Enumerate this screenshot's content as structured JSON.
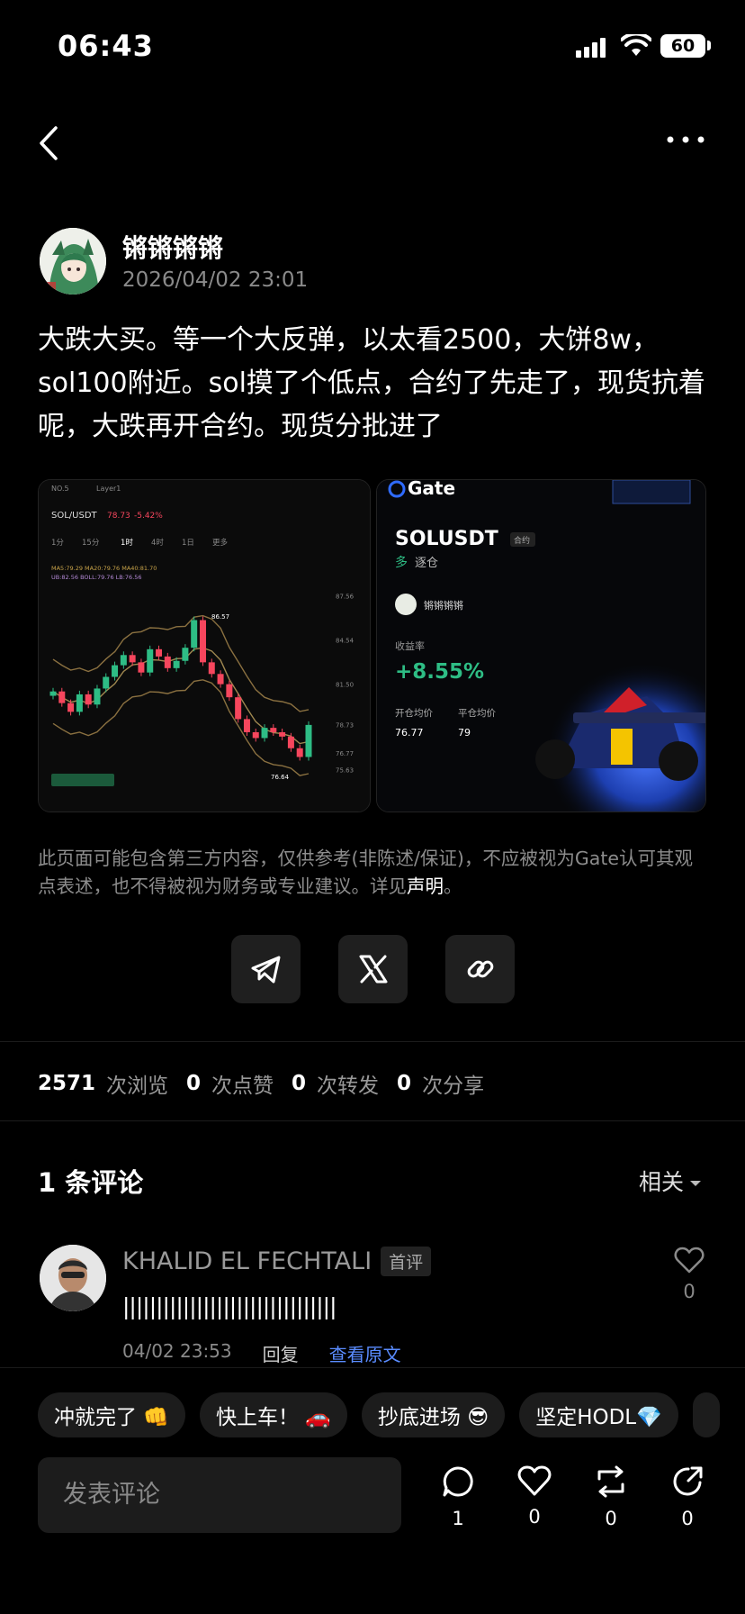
{
  "status": {
    "time": "06:43",
    "battery": "60"
  },
  "post": {
    "author": "锵锵锵锵",
    "time": "2026/04/02 23:01",
    "content": "大跌大买。等一个大反弹，以太看2500，大饼8w，sol100附近。sol摸了个低点，合约了先走了，现货抗着呢，大跌再开合约。现货分批进了",
    "chart_image": {
      "header": "NO.5",
      "layer": "Layer1",
      "pair": "SOL/USDT",
      "price": "78.73",
      "change": "-5.42%",
      "intervals": [
        "1分",
        "15分",
        "1时",
        "4时",
        "1日",
        "更多"
      ],
      "ma_line": "MA5:79.29  MA20:79.76  MA40:81.70",
      "boll_line": "UB:82.56  BOLL:79.76  LB:76.56",
      "high_marker": "86.57",
      "low_marker": "76.64",
      "y_ticks": [
        "87.56",
        "84.54",
        "81.50",
        "78.73",
        "76.77",
        "75.63"
      ],
      "chart_data": {
        "type": "line",
        "x": [
          1,
          2,
          3,
          4,
          5,
          6,
          7,
          8,
          9,
          10,
          11,
          12,
          13,
          14,
          15,
          16,
          17,
          18,
          19,
          20,
          21,
          22,
          23,
          24,
          25,
          26,
          27,
          28,
          29,
          30
        ],
        "series": [
          {
            "values": [
              81.0,
              80.2,
              79.6,
              80.8,
              80.1,
              81.2,
              82.0,
              82.8,
              83.5,
              83.0,
              82.3,
              83.9,
              83.4,
              82.6,
              83.1,
              84.0,
              85.9,
              83.0,
              82.2,
              81.5,
              80.6,
              79.1,
              78.2,
              77.8,
              78.5,
              78.2,
              77.9,
              77.1,
              76.5,
              78.7
            ]
          }
        ],
        "ylim": [
          75.6,
          87.6
        ]
      }
    },
    "pnl_card": {
      "brand": "Gate",
      "symbol": "SOLUSDT",
      "contract_tag": "合约",
      "direction": "多",
      "mode": "逐仓",
      "user": "锵锵锵锵",
      "yield_label": "收益率",
      "yield": "+8.55%",
      "open_label": "开仓均价",
      "close_label": "平仓均价",
      "open_price": "76.77",
      "close_price": "79"
    },
    "disclaimer": "此页面可能包含第三方内容，仅供参考(非陈述/保证)，不应被视为Gate认可其观点表述，也不得被视为财务或专业建议。详见",
    "disclaimer_link": "声明",
    "disclaimer_end": "。"
  },
  "share": [
    "telegram-icon",
    "x-icon",
    "link-icon"
  ],
  "stats": {
    "views": "2571",
    "views_label": "次浏览",
    "likes": "0",
    "likes_label": "次点赞",
    "reposts": "0",
    "reposts_label": "次转发",
    "shares": "0",
    "shares_label": "次分享"
  },
  "comments": {
    "count_label": "1 条评论",
    "sort": "相关",
    "items": [
      {
        "name": "KHALID EL FECHTALI",
        "badge": "首评",
        "text": "||||||||||||||||||||||||||||||||",
        "time": "04/02 23:53",
        "reply": "回复",
        "view_original": "查看原文",
        "likes": "0"
      }
    ]
  },
  "quick_chips": [
    "冲就完了 👊",
    "快上车！ 🚗",
    "抄底进场 😎",
    "坚定HODL💎"
  ],
  "composer": {
    "placeholder": "发表评论"
  },
  "actions": {
    "comments": "1",
    "likes": "0",
    "reposts": "0",
    "shares": "0"
  },
  "colors": {
    "accent_green": "#2ebd85",
    "accent_red": "#f6465d",
    "link_blue": "#5a8cff"
  }
}
